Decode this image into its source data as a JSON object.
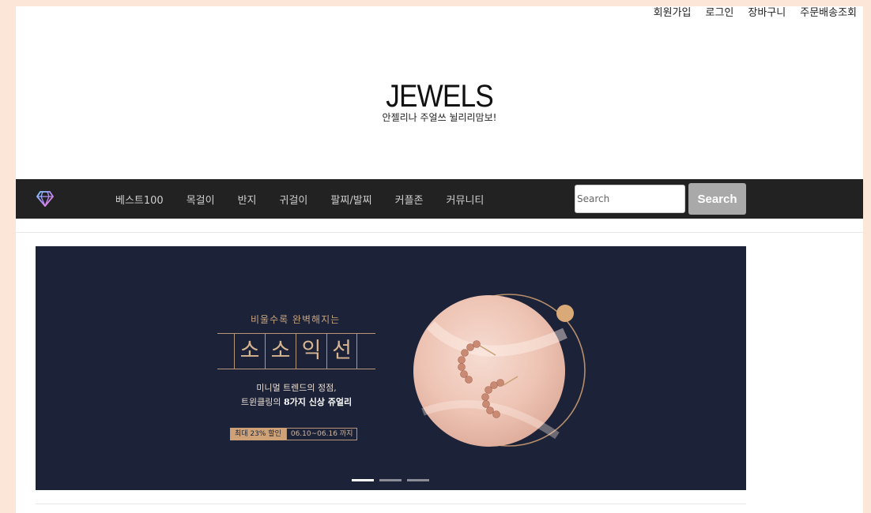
{
  "top_links": [
    "회원가입",
    "로그인",
    "장바구니",
    "주문배송조회"
  ],
  "logo": {
    "title": "JEWELS",
    "subtitle": "안젤리나 주얼쓰 뉠리리맘보!"
  },
  "nav": {
    "items": [
      "베스트100",
      "목걸이",
      "반지",
      "귀걸이",
      "팔찌/발찌",
      "커플존",
      "커뮤니티"
    ],
    "search_placeholder": "Search",
    "search_button": "Search"
  },
  "banner": {
    "line1": "비울수록 완벽해지는",
    "chars": [
      "소",
      "소",
      "익",
      "선"
    ],
    "line2": "미니멀 트렌드의 정점,",
    "line3_pre": "트윈클링의 ",
    "line3_bold": "8가지 신상 쥬얼리",
    "badge_sale": "최대 23% 할인",
    "badge_dates": "06.10~06.16 까지",
    "slides": 3,
    "active_slide": 1
  },
  "colors": {
    "nav_bg": "#222222",
    "banner_bg": "#1c2237",
    "accent_gold": "#cea276",
    "page_bg": "#fbe6d8"
  }
}
